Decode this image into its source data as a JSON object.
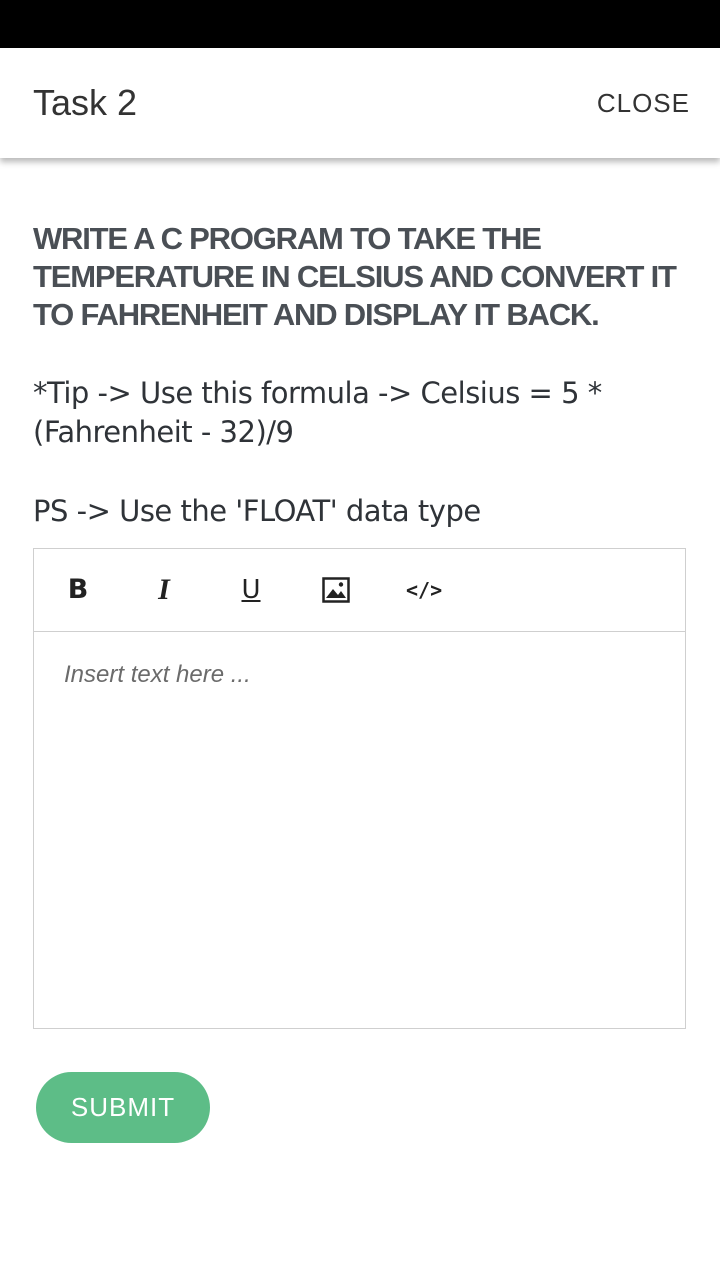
{
  "header": {
    "title": "Task 2",
    "close_label": "CLOSE"
  },
  "task": {
    "question": "WRITE A C PROGRAM TO TAKE THE TEMPERATURE IN CELSIUS AND CONVERT IT TO FAHRENHEIT AND DISPLAY IT BACK.",
    "tip": "*Tip -> Use this formula -> Celsius = 5 * (Fahrenheit - 32)/9",
    "ps": "PS -> Use the 'FLOAT' data type"
  },
  "editor": {
    "toolbar": {
      "bold": "B",
      "italic": "I",
      "underline": "U",
      "code": "</>"
    },
    "placeholder": "Insert text here ..."
  },
  "submit_label": "SUBMIT",
  "colors": {
    "accent": "#5dbd87",
    "status_bar": "#000000"
  },
  "icons": {
    "image": "image-icon"
  }
}
